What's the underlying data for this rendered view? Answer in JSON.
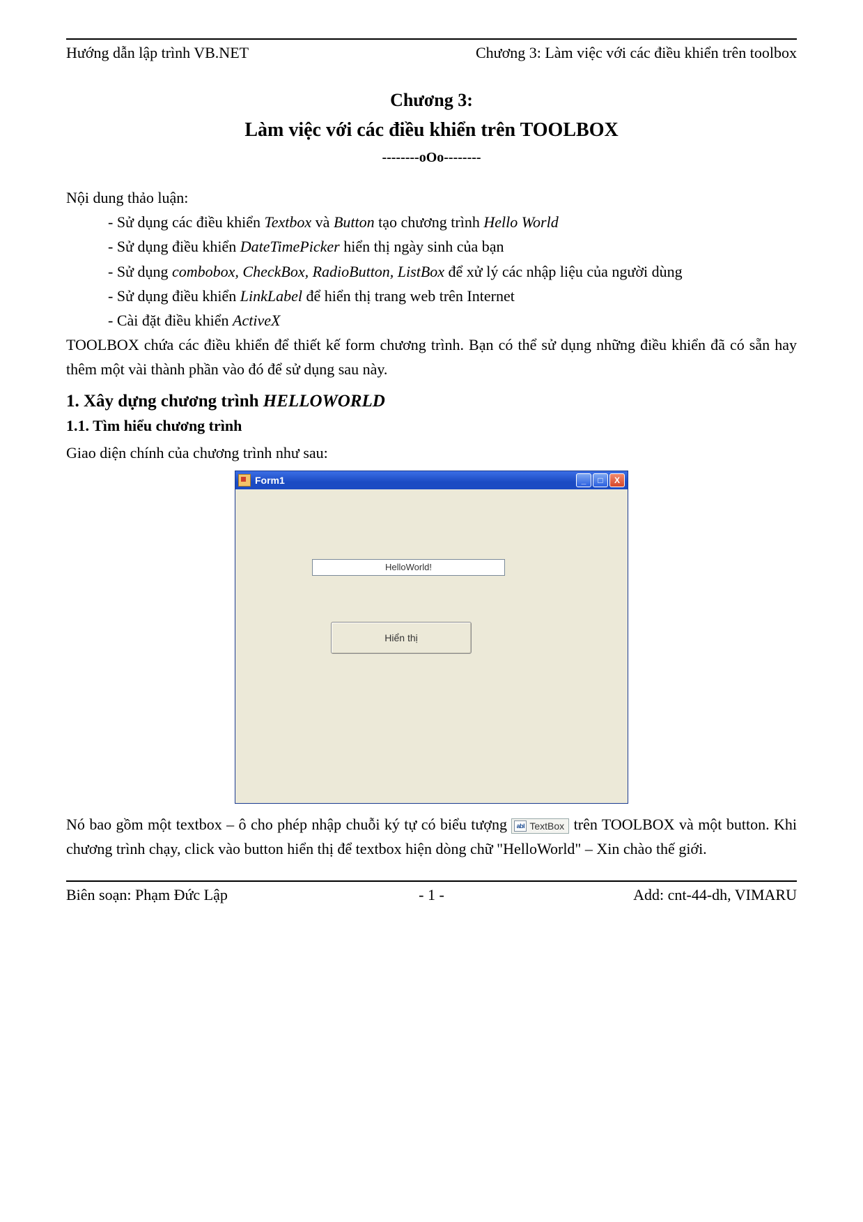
{
  "header": {
    "left": "Hướng dẫn lập trình VB.NET",
    "right": "Chương 3: Làm việc với các điều khiển trên toolbox"
  },
  "chapter": {
    "number": "Chương 3:",
    "title": "Làm việc với các điều khiển trên TOOLBOX",
    "ornament": "--------oOo--------"
  },
  "intro_heading": "Nội dung thảo luận:",
  "bullets": {
    "b1_a": "- Sử dụng các điều khiển ",
    "b1_i1": "Textbox",
    "b1_b": "  và ",
    "b1_i2": "Button",
    "b1_c": " tạo chương trình ",
    "b1_i3": "Hello World",
    "b2_a": "- Sử dụng điều khiển ",
    "b2_i1": "DateTimePicker",
    "b2_b": " hiển thị ngày sinh của bạn",
    "b3_a": "- Sử dụng ",
    "b3_i1": "combobox, CheckBox, RadioButton, ListBox",
    "b3_b": " để xử lý các nhập liệu của người dùng",
    "b4_a": "- Sử dụng điều khiển ",
    "b4_i1": "LinkLabel",
    "b4_b": " để hiển thị trang web trên Internet",
    "b5_a": "- Cài đặt điều khiển ",
    "b5_i1": "ActiveX"
  },
  "para_toolbox": "TOOLBOX chứa các điều khiển để thiết kế form chương trình. Bạn có thể sử dụng những điều khiển đã có sẵn hay thêm một vài thành phần vào đó để sử dụng sau này.",
  "section1": {
    "num_text": "1. Xây dựng chương trình ",
    "title_italic": "HELLOWORLD"
  },
  "section1_1": "1.1. Tìm hiểu chương trình",
  "gui_intro": "Giao diện chính của chương trình như sau:",
  "form": {
    "title": "Form1",
    "textbox_value": "HelloWorld!",
    "button_label": "Hiển thị",
    "min_glyph": "_",
    "max_glyph": "□",
    "close_glyph": "X"
  },
  "toolbox_chip": {
    "icon_text": "abl",
    "label": "TextBox"
  },
  "para2": {
    "a": "Nó bao gồm một textbox – ô cho phép nhập chuỗi ký tự có biểu tượng ",
    "b": " trên TOOLBOX và một button. Khi chương trình chạy, click vào button hiển thị để textbox hiện dòng chữ \"HelloWorld\" – Xin chào thế giới."
  },
  "footer": {
    "left": "Biên soạn: Phạm Đức Lập",
    "center": "- 1 -",
    "right": "Add: cnt-44-dh, VIMARU"
  }
}
